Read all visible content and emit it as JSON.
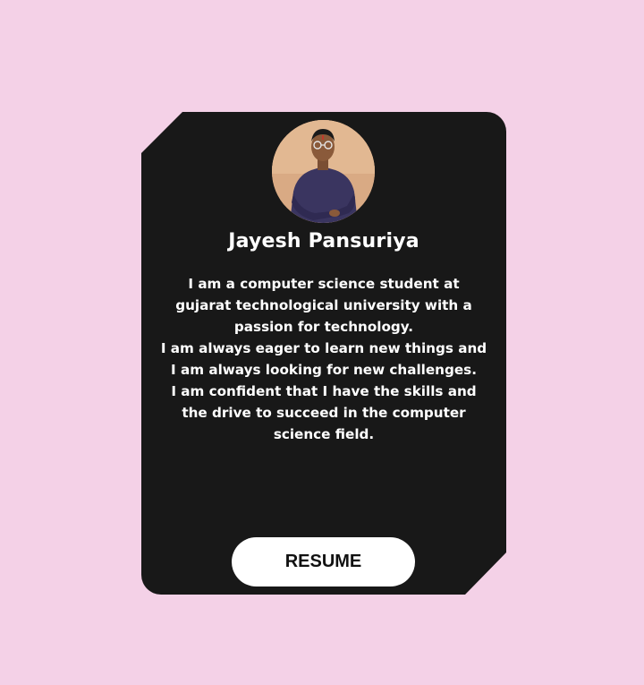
{
  "profile": {
    "name": "Jayesh Pansuriya",
    "avatar_icon": "person-photo",
    "bio": [
      "I am a computer science student at gujarat technological university with a passion for technology.",
      "I am always eager to learn new things and I am always looking for new challenges.",
      "I am confident that I have the skills and the drive to succeed in the computer science field."
    ]
  },
  "actions": {
    "resume_label": "RESUME"
  },
  "colors": {
    "background": "#f4d1e7",
    "card": "#181818",
    "text": "#ffffff",
    "button": "#ffffff",
    "button_text": "#111111"
  }
}
